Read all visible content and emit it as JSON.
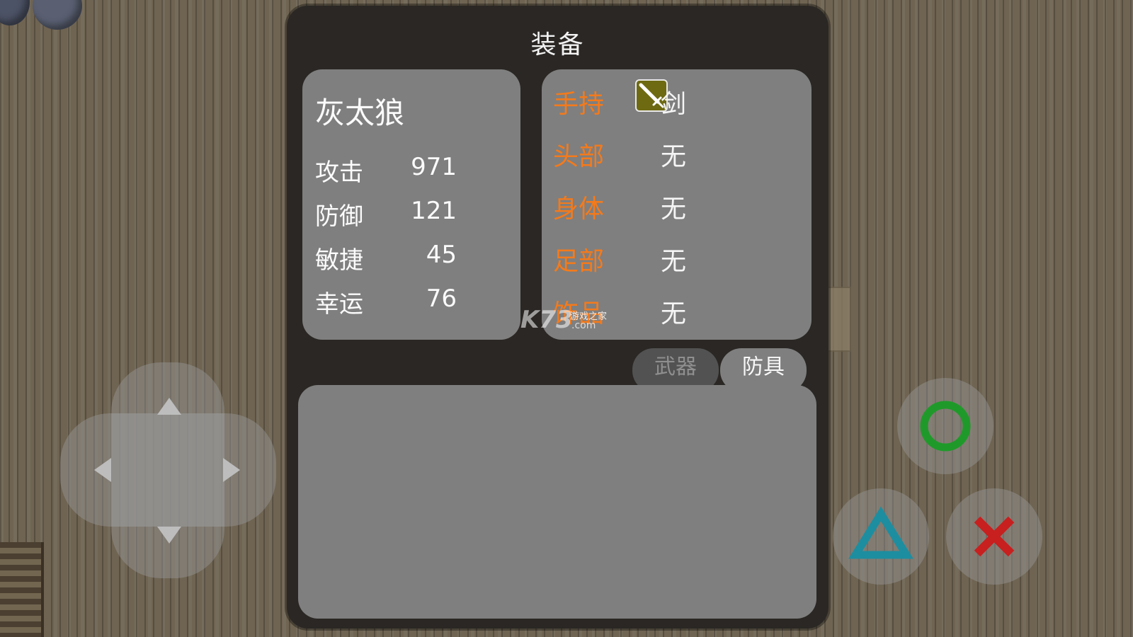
{
  "panel": {
    "title": "装备"
  },
  "character": {
    "name": "灰太狼",
    "stats": [
      {
        "label": "攻击",
        "value": "971"
      },
      {
        "label": "防御",
        "value": "121"
      },
      {
        "label": "敏捷",
        "value": "45"
      },
      {
        "label": "幸运",
        "value": "76"
      }
    ]
  },
  "equipment": {
    "slots": [
      {
        "label": "手持",
        "item": "剑",
        "icon": "sword-icon"
      },
      {
        "label": "头部",
        "item": "无"
      },
      {
        "label": "身体",
        "item": "无"
      },
      {
        "label": "足部",
        "item": "无"
      },
      {
        "label": "饰品",
        "item": "无"
      }
    ]
  },
  "tabs": {
    "weapon": "武器",
    "armor": "防具",
    "active": "armor"
  },
  "watermark": {
    "brand": "K73",
    "text": "游戏之家",
    "domain": ".com"
  },
  "controls": {
    "dpad": [
      "up-arrow-icon",
      "down-arrow-icon",
      "left-arrow-icon",
      "right-arrow-icon"
    ],
    "buttons": [
      {
        "name": "circle",
        "color": "#1f9a2a"
      },
      {
        "name": "triangle",
        "color": "#1d8ea0"
      },
      {
        "name": "cross",
        "color": "#c81f1f"
      }
    ]
  },
  "colors": {
    "slot_label": "#f47a1b",
    "card_bg": "#7f7f7f",
    "panel_bg": "#2a2724",
    "sword_icon_bg": "#6d6a12"
  }
}
